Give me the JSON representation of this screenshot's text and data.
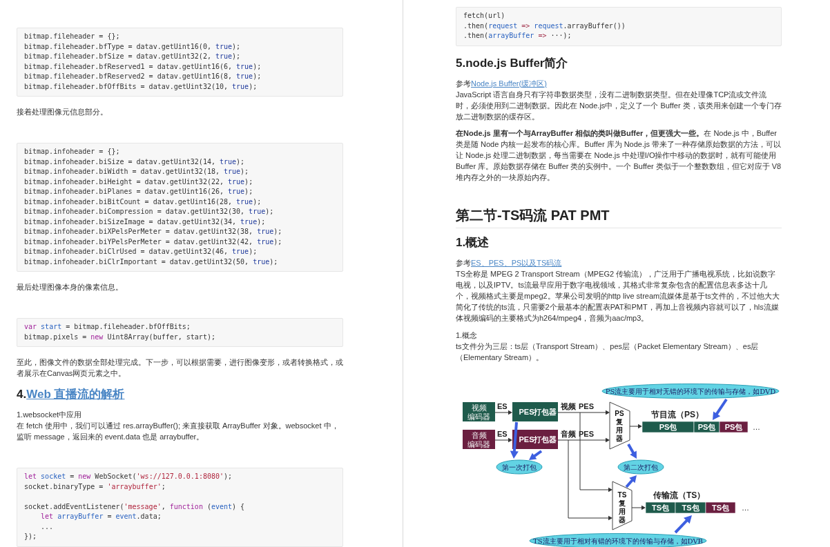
{
  "pages": [
    {
      "blocks": [
        {
          "kind": "code",
          "lines": [
            {
              "segments": [
                {
                  "text": "bitmap.fileheader = {};",
                  "kind": "plain"
                }
              ]
            },
            {
              "segments": [
                {
                  "text": "bitmap.fileheader.bfType = datav.getUint16(0, ",
                  "kind": "plain"
                },
                {
                  "text": "true",
                  "kind": "literal"
                },
                {
                  "text": ");",
                  "kind": "plain"
                }
              ]
            },
            {
              "segments": [
                {
                  "text": "bitmap.fileheader.bfSize = datav.getUint32(2, ",
                  "kind": "plain"
                },
                {
                  "text": "true",
                  "kind": "literal"
                },
                {
                  "text": ");",
                  "kind": "plain"
                }
              ]
            },
            {
              "segments": [
                {
                  "text": "bitmap.fileheader.bfReserved1 = datav.getUint16(6, ",
                  "kind": "plain"
                },
                {
                  "text": "true",
                  "kind": "literal"
                },
                {
                  "text": ");",
                  "kind": "plain"
                }
              ]
            },
            {
              "segments": [
                {
                  "text": "bitmap.fileheader.bfReserved2 = datav.getUint16(8, ",
                  "kind": "plain"
                },
                {
                  "text": "true",
                  "kind": "literal"
                },
                {
                  "text": ");",
                  "kind": "plain"
                }
              ]
            },
            {
              "segments": [
                {
                  "text": "bitmap.fileheader.bfOffBits = datav.getUint32(10, ",
                  "kind": "plain"
                },
                {
                  "text": "true",
                  "kind": "literal"
                },
                {
                  "text": ");",
                  "kind": "plain"
                }
              ]
            }
          ]
        },
        {
          "kind": "para",
          "text": "接着处理图像元信息部分。"
        },
        {
          "kind": "code",
          "lines": [
            {
              "segments": [
                {
                  "text": "bitmap.infoheader = {};",
                  "kind": "plain"
                }
              ]
            },
            {
              "segments": [
                {
                  "text": "bitmap.infoheader.biSize = datav.getUint32(14, ",
                  "kind": "plain"
                },
                {
                  "text": "true",
                  "kind": "literal"
                },
                {
                  "text": ");",
                  "kind": "plain"
                }
              ]
            },
            {
              "segments": [
                {
                  "text": "bitmap.infoheader.biWidth = datav.getUint32(18, ",
                  "kind": "plain"
                },
                {
                  "text": "true",
                  "kind": "literal"
                },
                {
                  "text": ");",
                  "kind": "plain"
                }
              ]
            },
            {
              "segments": [
                {
                  "text": "bitmap.infoheader.biHeight = datav.getUint32(22, ",
                  "kind": "plain"
                },
                {
                  "text": "true",
                  "kind": "literal"
                },
                {
                  "text": ");",
                  "kind": "plain"
                }
              ]
            },
            {
              "segments": [
                {
                  "text": "bitmap.infoheader.biPlanes = datav.getUint16(26, ",
                  "kind": "plain"
                },
                {
                  "text": "true",
                  "kind": "literal"
                },
                {
                  "text": ");",
                  "kind": "plain"
                }
              ]
            },
            {
              "segments": [
                {
                  "text": "bitmap.infoheader.biBitCount = datav.getUint16(28, ",
                  "kind": "plain"
                },
                {
                  "text": "true",
                  "kind": "literal"
                },
                {
                  "text": ");",
                  "kind": "plain"
                }
              ]
            },
            {
              "segments": [
                {
                  "text": "bitmap.infoheader.biCompression = datav.getUint32(30, ",
                  "kind": "plain"
                },
                {
                  "text": "true",
                  "kind": "literal"
                },
                {
                  "text": ");",
                  "kind": "plain"
                }
              ]
            },
            {
              "segments": [
                {
                  "text": "bitmap.infoheader.biSizeImage = datav.getUint32(34, ",
                  "kind": "plain"
                },
                {
                  "text": "true",
                  "kind": "literal"
                },
                {
                  "text": ");",
                  "kind": "plain"
                }
              ]
            },
            {
              "segments": [
                {
                  "text": "bitmap.infoheader.biXPelsPerMeter = datav.getUint32(38, ",
                  "kind": "plain"
                },
                {
                  "text": "true",
                  "kind": "literal"
                },
                {
                  "text": ");",
                  "kind": "plain"
                }
              ]
            },
            {
              "segments": [
                {
                  "text": "bitmap.infoheader.biYPelsPerMeter = datav.getUint32(42, ",
                  "kind": "plain"
                },
                {
                  "text": "true",
                  "kind": "literal"
                },
                {
                  "text": ");",
                  "kind": "plain"
                }
              ]
            },
            {
              "segments": [
                {
                  "text": "bitmap.infoheader.biClrUsed = datav.getUint32(46, ",
                  "kind": "plain"
                },
                {
                  "text": "true",
                  "kind": "literal"
                },
                {
                  "text": ");",
                  "kind": "plain"
                }
              ]
            },
            {
              "segments": [
                {
                  "text": "bitmap.infoheader.biClrImportant = datav.getUint32(50, ",
                  "kind": "plain"
                },
                {
                  "text": "true",
                  "kind": "literal"
                },
                {
                  "text": ");",
                  "kind": "plain"
                }
              ]
            }
          ]
        },
        {
          "kind": "para",
          "text": "最后处理图像本身的像素信息。"
        },
        {
          "kind": "code",
          "lines": [
            {
              "segments": [
                {
                  "text": "var ",
                  "kind": "keyword"
                },
                {
                  "text": "start",
                  "kind": "variable"
                },
                {
                  "text": " = bitmap.fileheader.bfOffBits;",
                  "kind": "plain"
                }
              ]
            },
            {
              "segments": [
                {
                  "text": "bitmap.pixels = ",
                  "kind": "plain"
                },
                {
                  "text": "new",
                  "kind": "keyword"
                },
                {
                  "text": " Uint8Array(buffer, start);",
                  "kind": "plain"
                }
              ]
            }
          ]
        },
        {
          "kind": "para",
          "text": "至此，图像文件的数据全部处理完成。下一步，可以根据需要，进行图像变形，或者转换格式，或者展示在Canvas网页元素之中。"
        },
        {
          "kind": "heading",
          "number": "4.",
          "link": "Web 直播流的解析"
        },
        {
          "kind": "label",
          "text": "1.websocket中应用"
        },
        {
          "kind": "para",
          "text": "在 fetch 使用中，我们可以通过 res.arrayBuffer(); 来直接获取 ArrayBuffer 对象。websocket 中，监听 message，返回来的 event.data 也是 arraybuffer。"
        },
        {
          "kind": "code",
          "lines": [
            {
              "segments": [
                {
                  "text": "let ",
                  "kind": "keyword"
                },
                {
                  "text": "socket",
                  "kind": "variable"
                },
                {
                  "text": " = ",
                  "kind": "plain"
                },
                {
                  "text": "new",
                  "kind": "keyword"
                },
                {
                  "text": " WebSocket(",
                  "kind": "plain"
                },
                {
                  "text": "'ws://127.0.0.1:8080'",
                  "kind": "string"
                },
                {
                  "text": ");",
                  "kind": "plain"
                }
              ]
            },
            {
              "segments": [
                {
                  "text": "socket.binaryType = ",
                  "kind": "plain"
                },
                {
                  "text": "'arraybuffer'",
                  "kind": "string"
                },
                {
                  "text": ";",
                  "kind": "plain"
                }
              ]
            },
            {
              "blank_line_before": true,
              "segments": [
                {
                  "text": "socket.addEventListener(",
                  "kind": "plain"
                },
                {
                  "text": "'message'",
                  "kind": "string"
                },
                {
                  "text": ", ",
                  "kind": "plain"
                },
                {
                  "text": "function",
                  "kind": "keyword"
                },
                {
                  "text": " (",
                  "kind": "plain"
                },
                {
                  "text": "event",
                  "kind": "variable"
                },
                {
                  "text": ") {",
                  "kind": "plain"
                }
              ]
            },
            {
              "segments": [
                {
                  "text": "    let ",
                  "kind": "keyword"
                },
                {
                  "text": "arrayBuffer",
                  "kind": "variable"
                },
                {
                  "text": " = ",
                  "kind": "plain"
                },
                {
                  "text": "event",
                  "kind": "variable"
                },
                {
                  "text": ".data;",
                  "kind": "plain"
                }
              ]
            },
            {
              "segments": [
                {
                  "text": "    ...",
                  "kind": "plain"
                }
              ]
            },
            {
              "segments": [
                {
                  "text": "});",
                  "kind": "plain"
                }
              ]
            }
          ]
        }
      ]
    },
    {
      "blocks": [
        {
          "kind": "code",
          "lines": [
            {
              "segments": [
                {
                  "text": "fetch(url)",
                  "kind": "plain"
                }
              ]
            },
            {
              "segments": [
                {
                  "text": ".then(",
                  "kind": "plain"
                },
                {
                  "text": "request ",
                  "kind": "variable"
                },
                {
                  "text": "=> ",
                  "kind": "operator"
                },
                {
                  "text": "request",
                  "kind": "variable"
                },
                {
                  "text": ".arrayBuffer())",
                  "kind": "plain"
                }
              ]
            },
            {
              "segments": [
                {
                  "text": ".then(",
                  "kind": "plain"
                },
                {
                  "text": "arrayBuffer ",
                  "kind": "variable"
                },
                {
                  "text": "=>",
                  "kind": "operator"
                },
                {
                  "text": " ···);",
                  "kind": "plain"
                }
              ]
            }
          ]
        },
        {
          "kind": "heading",
          "text": "5.node.js Buffer简介"
        },
        {
          "kind": "reference",
          "prefix": "参考",
          "link": "Node.js Buffer(缓冲区)"
        },
        {
          "kind": "para",
          "text": "JavaScript 语言自身只有字符串数据类型，没有二进制数据类型。但在处理像TCP流或文件流时，必须使用到二进制数据。因此在 Node.js中，定义了一个 Buffer 类，该类用来创建一个专门存放二进制数据的缓存区。"
        },
        {
          "kind": "para",
          "text": "**在Node.js 里有一个与ArrayBuffer 相似的类叫做Buffer，但更强大一些。**在 Node.js 中，Buffer 类是随 Node 内核一起发布的核心库。Buffer 库为 Node.js 带来了一种存储原始数据的方法，可以让 Node.js 处理二进制数据，每当需要在 Node.js 中处理I/O操作中移动的数据时，就有可能使用 Buffer 库。原始数据存储在 Buffer 类的实例中。一个 Buffer 类似于一个整数数组，但它对应于 V8 堆内存之外的一块原始内存。"
        },
        {
          "kind": "title",
          "text": "第二节-TS码流 PAT PMT"
        },
        {
          "kind": "heading",
          "text": "1.概述"
        },
        {
          "kind": "reference",
          "prefix": "参考",
          "link": "ES、PES、PS以及TS码流"
        },
        {
          "kind": "para",
          "text": "TS全称是 MPEG 2 Transport Stream（MPEG2 传输流），广泛用于广播电视系统，比如说数字电视，以及IPTV。ts流最早应用于数字电视领域，其格式非常复杂包含的配置信息表多达十几个，视频格式主要是mpeg2。苹果公司发明的http live stream流媒体是基于ts文件的，不过他大大简化了传统的ts流，只需要2个最基本的配置表PAT和PMT，再加上音视频内容就可以了，hls流媒体视频编码的主要格式为h264/mpeg4，音频为aac/mp3。"
        },
        {
          "kind": "label",
          "text": "1.概念"
        },
        {
          "kind": "para",
          "text": "ts文件分为三层：ts层（Transport Stream）、pes层（Packet Elementary Stream）、es层（Elementary Stream）。"
        },
        {
          "kind": "diagram",
          "encoders": [
            {
              "label": [
                "视频",
                "编码器"
              ],
              "color": "#1f5b4c",
              "input": "ES",
              "packer": "PES打包器",
              "output": "视频",
              "output_type": "PES"
            },
            {
              "label": [
                "音频",
                "编码器"
              ],
              "color": "#6b1f40",
              "input": "ES",
              "packer": "PES打包器",
              "output": "音频",
              "output_type": "PES"
            }
          ],
          "ps_mux": [
            "PS",
            "复",
            "用",
            "器"
          ],
          "ts_mux": [
            "TS",
            "复",
            "用",
            "器"
          ],
          "ps_stream": {
            "title": "节目流（PS）",
            "packets": [
              {
                "label": "PS包",
                "color": "#1f5b4c"
              },
              {
                "label": "PS包",
                "color": "#1f5b4c"
              },
              {
                "label": "PS包",
                "color": "#6b1f40"
              }
            ],
            "more": "…"
          },
          "ts_stream": {
            "title": "传输流（TS）",
            "packets": [
              {
                "label": "TS包",
                "color": "#1f5b4c"
              },
              {
                "label": "TS包",
                "color": "#1f5b4c"
              },
              {
                "label": "TS包",
                "color": "#6b1f40"
              }
            ],
            "more": "…"
          },
          "first_packing": "第一次打包",
          "second_packing": "第二次打包",
          "ps_note": "PS流主要用于相对无错的环境下的传输与存储，如DVD",
          "ts_note": "TS流主要用于相对有错的环境下的传输与存储，如DVB"
        }
      ]
    }
  ]
}
